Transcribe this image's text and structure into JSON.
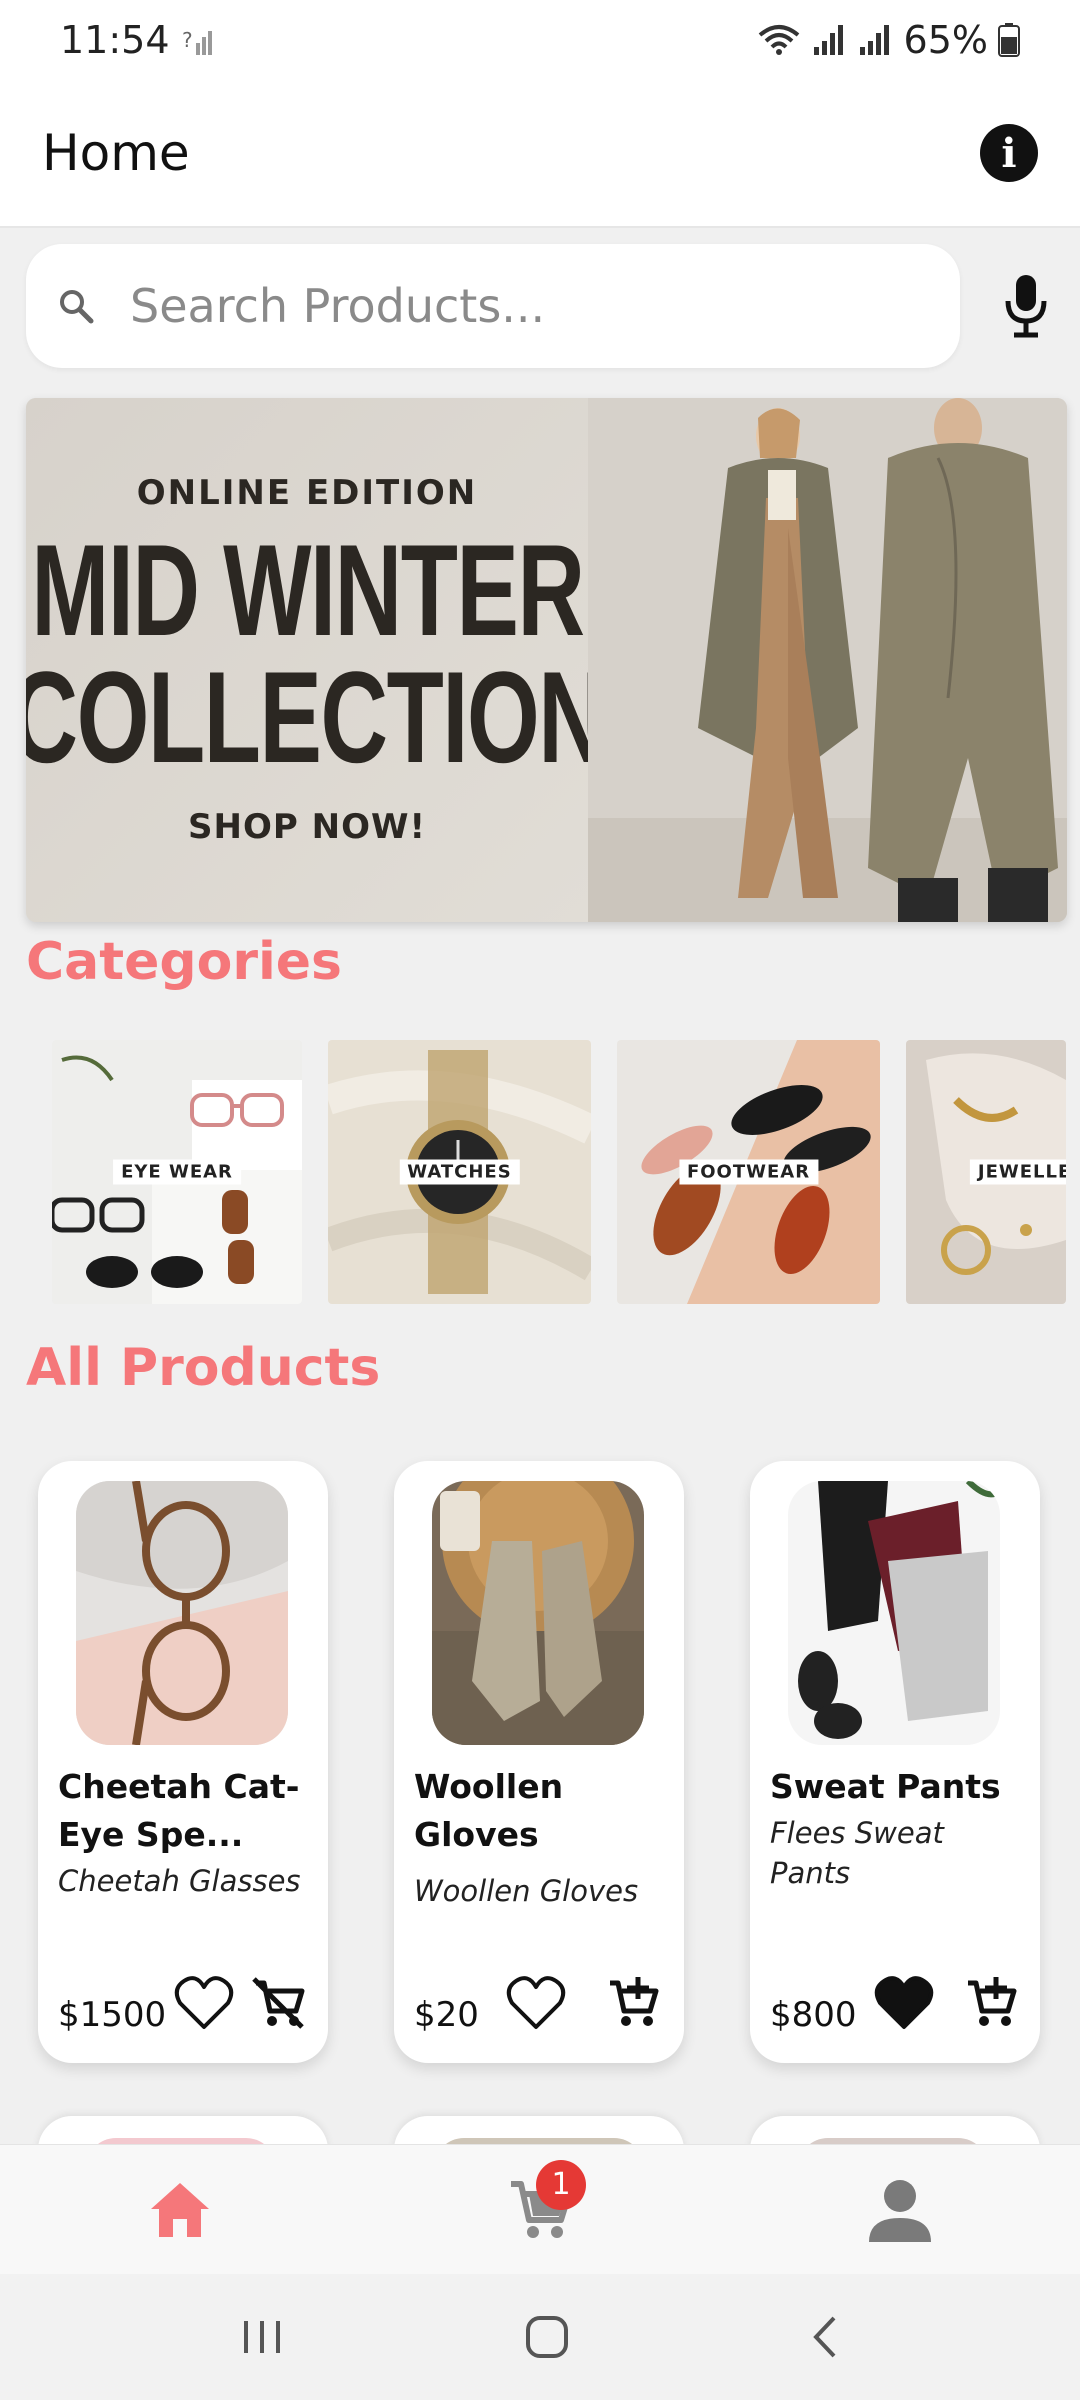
{
  "status_bar": {
    "time": "11:54",
    "battery": "65%"
  },
  "app_bar": {
    "title": "Home"
  },
  "search": {
    "placeholder": "Search Products..."
  },
  "banner": {
    "eyebrow": "ONLINE EDITION",
    "title_line1": "MID WINTER",
    "title_line2": "COLLECTION",
    "cta": "SHOP NOW!"
  },
  "sections": {
    "categories": "Categories",
    "all_products": "All Products"
  },
  "categories": [
    {
      "label": "EYE WEAR"
    },
    {
      "label": "WATCHES"
    },
    {
      "label": "FOOTWEAR"
    },
    {
      "label": "JEWELLER"
    }
  ],
  "products": [
    {
      "name": "Cheetah Cat-Eye Spe...",
      "desc": "Cheetah Glasses",
      "price": "$1500",
      "favorited": false,
      "in_cart": true
    },
    {
      "name": "Woollen Gloves",
      "desc": "Woollen Gloves",
      "price": "$20",
      "favorited": false,
      "in_cart": false
    },
    {
      "name": "Sweat Pants",
      "desc": "Flees Sweat Pants",
      "price": "$800",
      "favorited": true,
      "in_cart": false
    }
  ],
  "bottom_nav": {
    "cart_badge": "1",
    "active": "home",
    "accent": "#f5777a"
  }
}
